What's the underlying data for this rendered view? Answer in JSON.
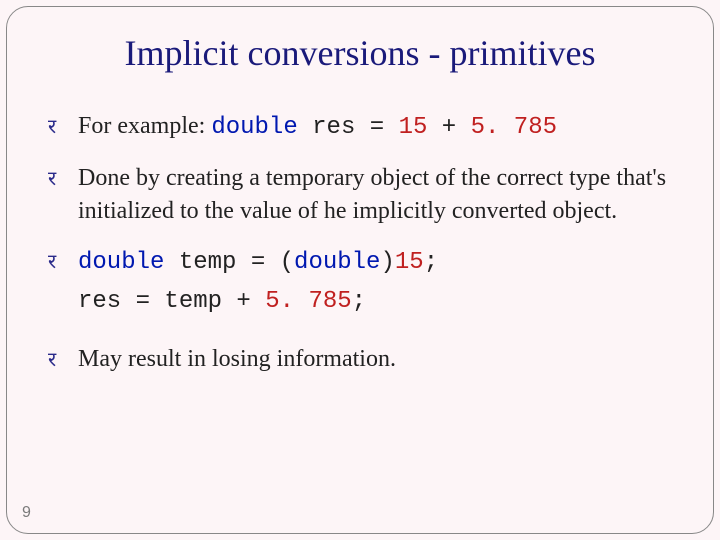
{
  "title": "Implicit conversions - primitives",
  "bullets": {
    "b1_prefix": "For example:  ",
    "b1_code_kw": "double",
    "b1_code_mid": " res = ",
    "b1_code_num1": "15",
    "b1_code_plus": " + ",
    "b1_code_num2": "5. 785",
    "b2_text": "Done by creating a temporary object of the correct type that's initialized to the value of he implicitly converted object.",
    "b3_code_kw1": "double",
    "b3_code_mid1": " temp = (",
    "b3_code_kw2": "double",
    "b3_code_mid2": ")",
    "b3_code_num1": "15",
    "b3_code_tail1": ";",
    "b3_line2_a": "res = temp + ",
    "b3_line2_num": "5. 785",
    "b3_line2_b": ";",
    "b4_text": "May result in losing information."
  },
  "bullet_glyph": "र",
  "page_number": "9"
}
